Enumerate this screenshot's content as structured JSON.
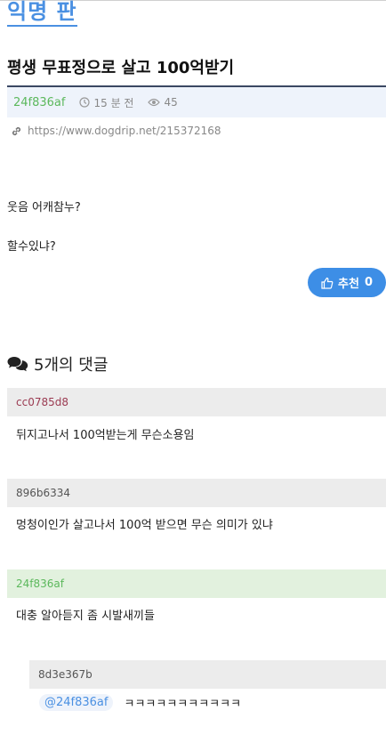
{
  "board": {
    "title": "익명 판"
  },
  "post": {
    "title": "평생 무표정으로 살고 100억받기",
    "author": "24f836af",
    "time": "15 분 전",
    "views": "45",
    "url": "https://www.dogdrip.net/215372168",
    "body_lines": [
      "웃음 어캐참누?",
      "할수있냐?"
    ]
  },
  "recommend": {
    "label": "추천",
    "count": "0"
  },
  "comments_section": {
    "heading": "5개의 댓글"
  },
  "comments": [
    {
      "author": "cc0785d8",
      "text": "뒤지고나서 100억받는게 무슨소용임"
    },
    {
      "author": "896b6334",
      "text": "멍청이인가 살고나서 100억 받으면 무슨 의미가 있냐"
    },
    {
      "author": "24f836af",
      "text": "대충 알아듣지 좀 시발새끼들"
    },
    {
      "author": "8d3e367b",
      "mention": "@24f836af",
      "text": "ㅋㅋㅋㅋㅋㅋㅋㅋㅋㅋㅋ"
    }
  ],
  "colors": {
    "accent": "#4a90e2",
    "author_green": "#5cb85c",
    "comment_author_red": "#9b3b52",
    "recommend_button": "#3d8ee6",
    "op_comment_bg": "#e2f1de",
    "comment_bg": "#ececec"
  }
}
